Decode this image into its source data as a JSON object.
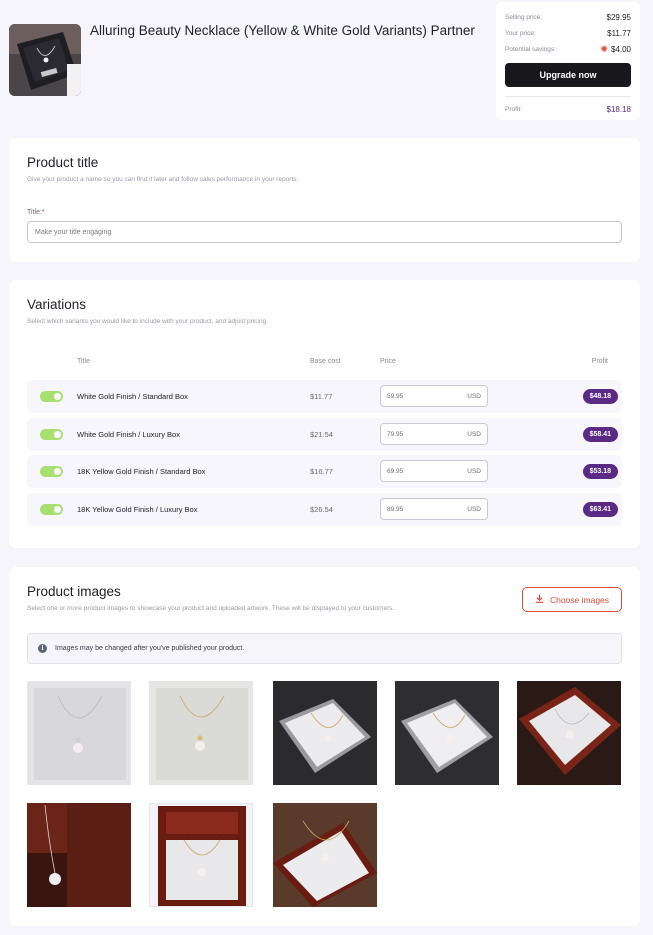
{
  "header": {
    "product_title": "Alluring Beauty Necklace (Yellow & White Gold Variants) Partner"
  },
  "pricing": {
    "selling_price_label": "Selling price:",
    "selling_price": "$29.95",
    "your_price_label": "Your price:",
    "your_price": "$11.77",
    "savings_label": "Potential savings:",
    "savings": "$4.00",
    "upgrade_label": "Upgrade now",
    "profit_label": "Profit:",
    "profit": "$18.18"
  },
  "product_title_section": {
    "heading": "Product title",
    "description": "Give your product a name so you can find it later and follow sales performance in your reports.",
    "field_label": "Title:",
    "required_mark": "*",
    "placeholder": "Make your title engaging"
  },
  "variations": {
    "heading": "Variations",
    "description": "Select which variants you would like to include with your product, and adjust pricing.",
    "columns": {
      "title": "Title",
      "base_cost": "Base cost",
      "price": "Price",
      "profit": "Profit"
    },
    "rows": [
      {
        "title": "White Gold Finish / Standard Box",
        "base_cost": "$11.77",
        "price": "59.95",
        "currency": "USD",
        "profit": "$48.18",
        "enabled": true
      },
      {
        "title": "White Gold Finish / Luxury Box",
        "base_cost": "$21.54",
        "price": "79.95",
        "currency": "USD",
        "profit": "$58.41",
        "enabled": true
      },
      {
        "title": "18K Yellow Gold Finish / Standard Box",
        "base_cost": "$16.77",
        "price": "69.95",
        "currency": "USD",
        "profit": "$53.18",
        "enabled": true
      },
      {
        "title": "18K Yellow Gold Finish / Luxury Box",
        "base_cost": "$26.54",
        "price": "89.95",
        "currency": "USD",
        "profit": "$63.41",
        "enabled": true
      }
    ]
  },
  "images_section": {
    "heading": "Product images",
    "description": "Select one or more product images to showcase your product and uploaded artwork. These will be displayed to your customers.",
    "choose_label": "Choose images",
    "info_text": "Images may be changed after you've published your product."
  },
  "colors": {
    "accent_purple": "#5b2a86",
    "toggle_green": "#a8e070",
    "danger_red": "#e0483a",
    "button_dark": "#17171c"
  }
}
